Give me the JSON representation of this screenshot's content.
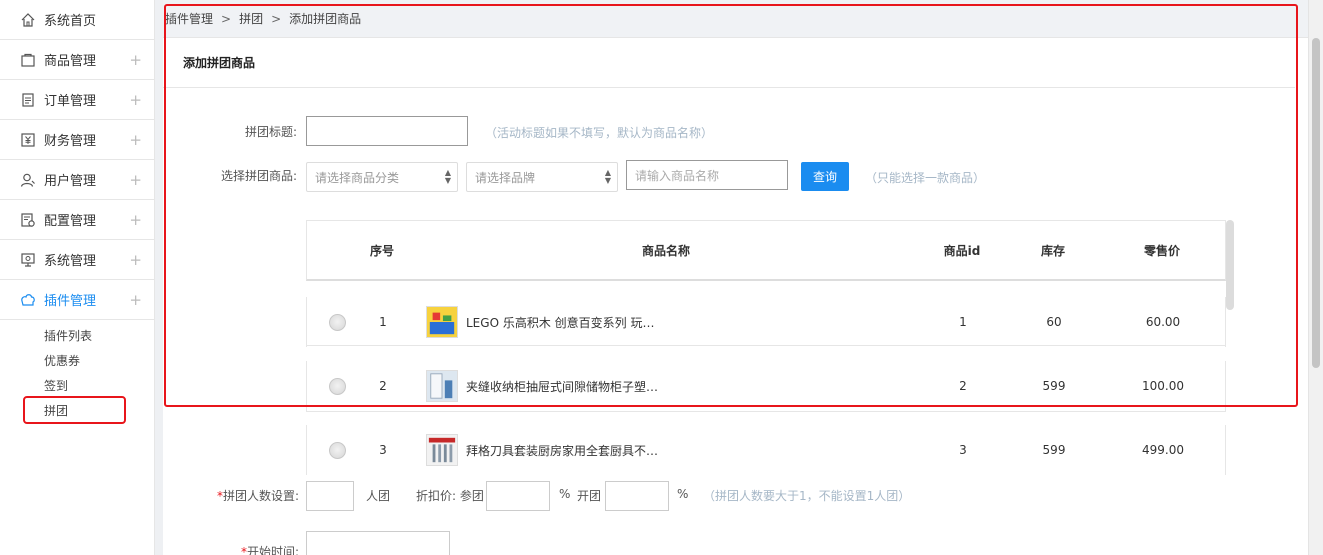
{
  "sidebar": {
    "items": [
      {
        "label": "系统首页",
        "icon": "home-icon",
        "expandable": false
      },
      {
        "label": "商品管理",
        "icon": "bag-icon",
        "expandable": true
      },
      {
        "label": "订单管理",
        "icon": "order-icon",
        "expandable": true
      },
      {
        "label": "财务管理",
        "icon": "finance-icon",
        "expandable": true
      },
      {
        "label": "用户管理",
        "icon": "user-icon",
        "expandable": true
      },
      {
        "label": "配置管理",
        "icon": "config-icon",
        "expandable": true
      },
      {
        "label": "系统管理",
        "icon": "monitor-icon",
        "expandable": true
      },
      {
        "label": "插件管理",
        "icon": "plugin-icon",
        "expandable": true,
        "active": true
      }
    ],
    "plus": "+",
    "subitems": [
      {
        "label": "插件列表"
      },
      {
        "label": "优惠券"
      },
      {
        "label": "签到"
      },
      {
        "label": "拼团",
        "current": true
      }
    ]
  },
  "breadcrumb": [
    "插件管理",
    "拼团",
    "添加拼团商品"
  ],
  "breadcrumb_sep": ">",
  "card_title": "添加拼团商品",
  "form": {
    "title_label": "拼团标题:",
    "title_value": "",
    "title_hint": "（活动标题如果不填写，默认为商品名称）",
    "goods_label": "选择拼团商品:",
    "category_placeholder": "请选择商品分类",
    "brand_placeholder": "请选择品牌",
    "name_placeholder": "请输入商品名称",
    "query_button": "查询",
    "goods_hint": "（只能选择一款商品）",
    "people_label": "拼团人数设置:",
    "people_unit": "人团",
    "discount_label": "折扣价: 参团",
    "percent": "%",
    "open_label": "开团",
    "people_hint": "（拼团人数要大于1，不能设置1人团）",
    "start_label": "开始时间:",
    "required_mark": "*"
  },
  "table": {
    "headers": [
      "序号",
      "商品名称",
      "商品id",
      "库存",
      "零售价"
    ],
    "rows": [
      {
        "no": "1",
        "name": "LEGO 乐高积木 创意百变系列 玩…",
        "id": "1",
        "stock": "60",
        "price": "60.00",
        "thumb": "lego-thumb"
      },
      {
        "no": "2",
        "name": "夹缝收纳柜抽屉式间隙储物柜子塑…",
        "id": "2",
        "stock": "599",
        "price": "100.00",
        "thumb": "cabinet-thumb"
      },
      {
        "no": "3",
        "name": "拜格刀具套装厨房家用全套厨具不…",
        "id": "3",
        "stock": "599",
        "price": "499.00",
        "thumb": "knife-thumb"
      }
    ]
  },
  "colors": {
    "accent": "#1a8cf0",
    "highlight": "#e8151b",
    "hint": "#a6b7c7"
  }
}
